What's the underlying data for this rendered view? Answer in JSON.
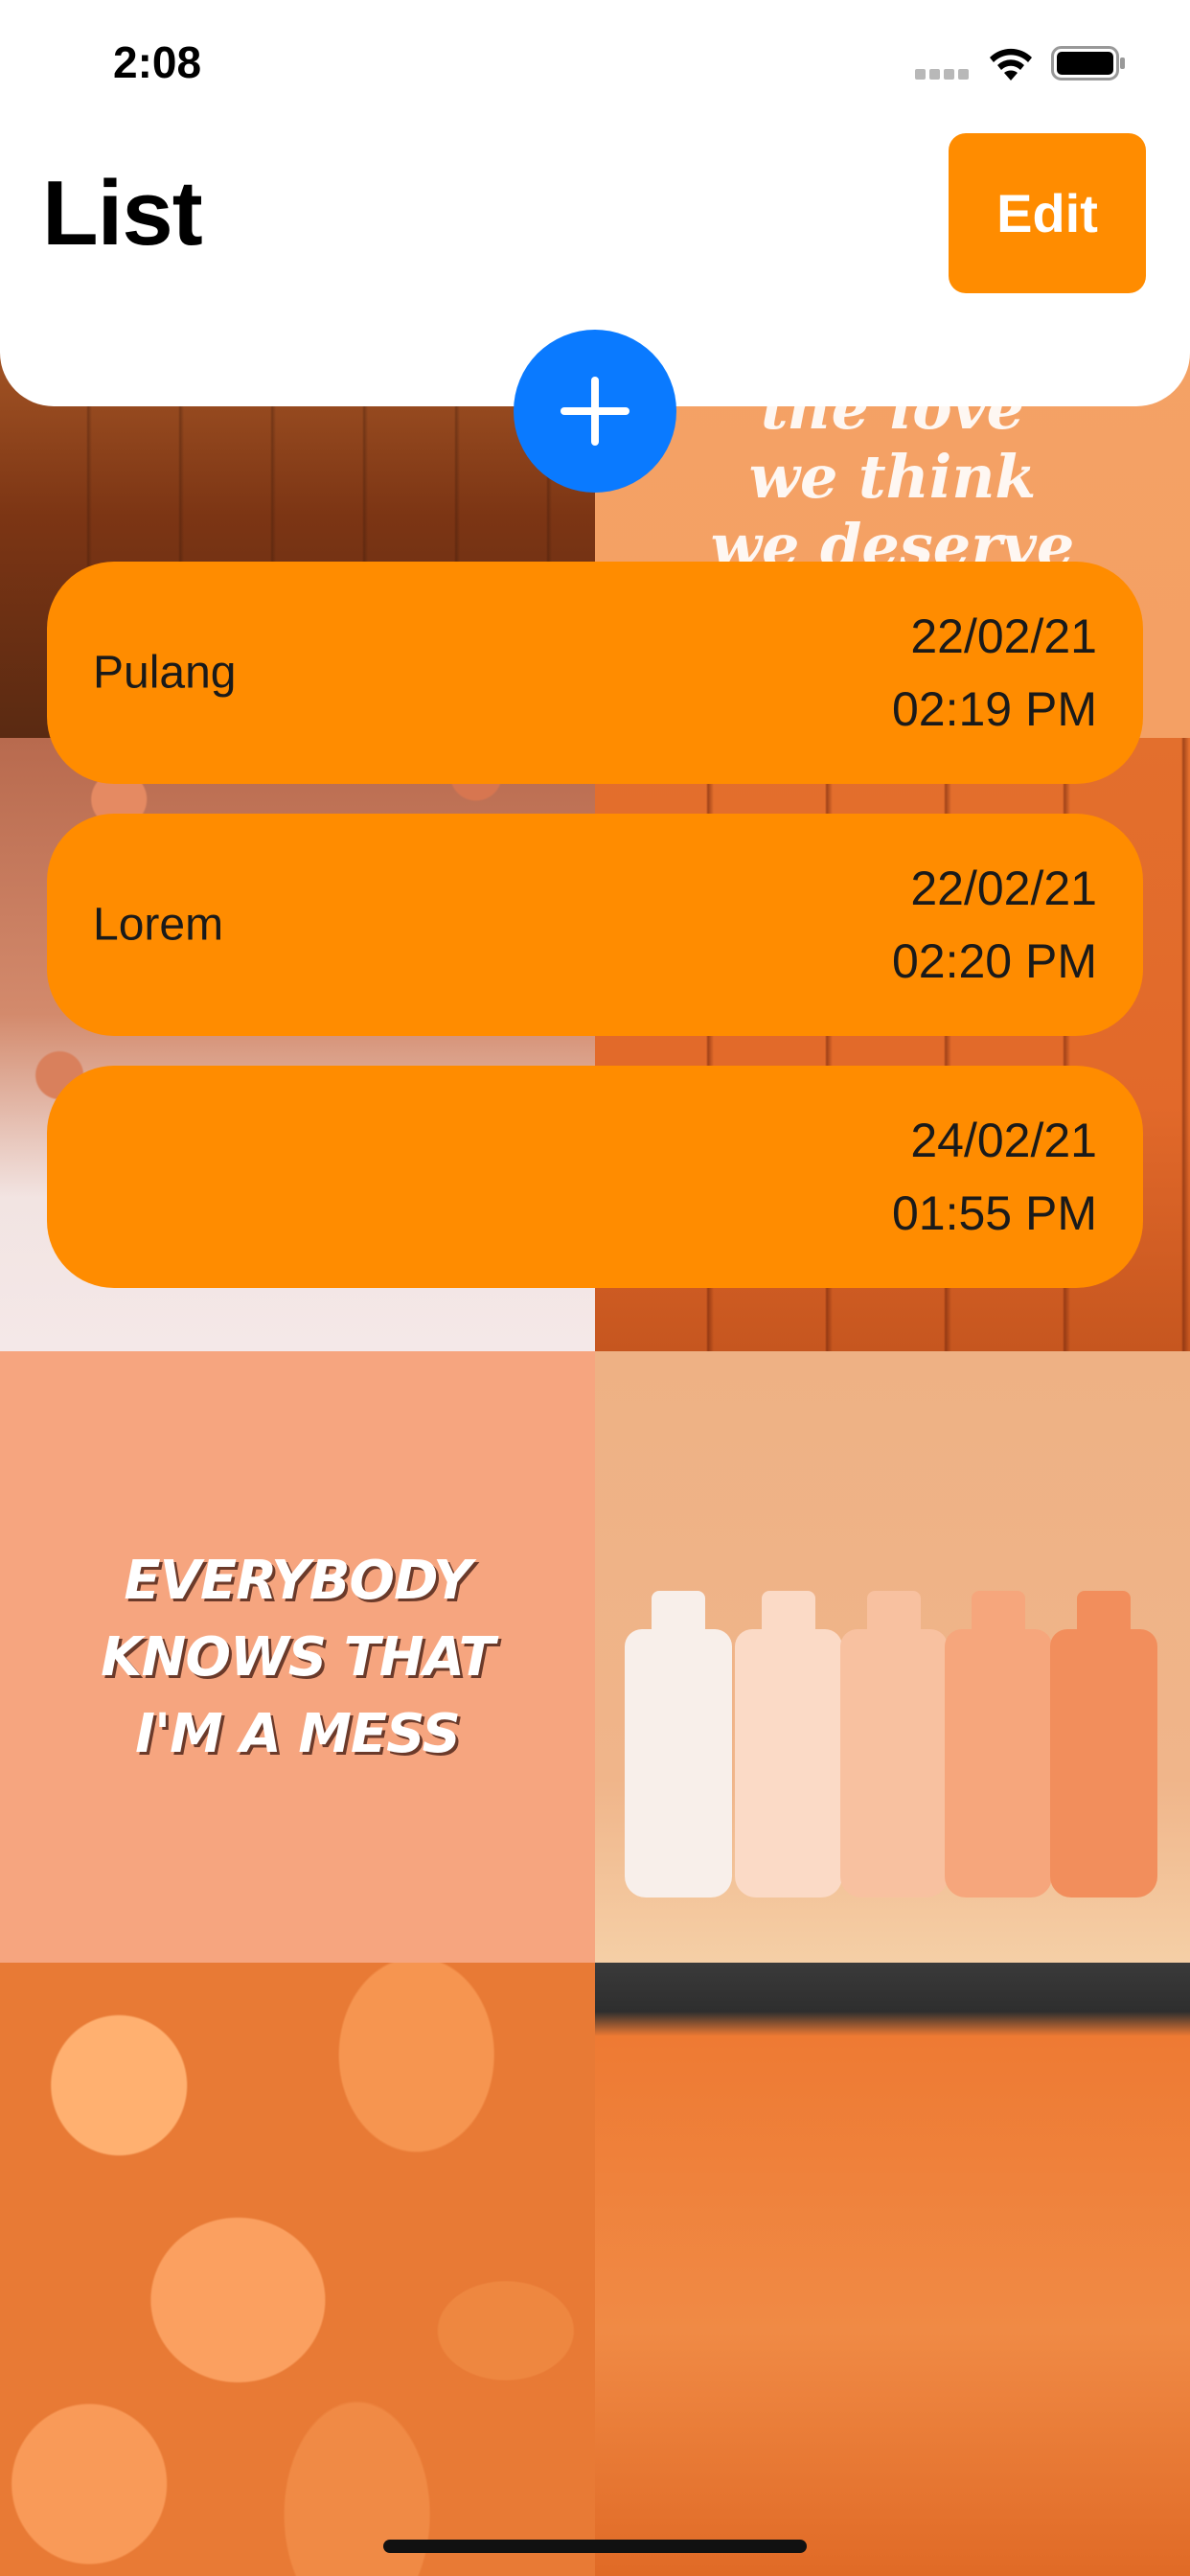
{
  "status_bar": {
    "time": "2:08",
    "icons": [
      "signal-icon",
      "wifi-icon",
      "battery-icon"
    ]
  },
  "header": {
    "title": "List",
    "edit_label": "Edit"
  },
  "add_button": {
    "icon": "plus-icon"
  },
  "items": [
    {
      "title": "Pulang",
      "date": "22/02/21",
      "time": "02:19 PM"
    },
    {
      "title": "Lorem",
      "date": "22/02/21",
      "time": "02:20 PM"
    },
    {
      "title": "",
      "date": "24/02/21",
      "time": "01:55 PM"
    }
  ],
  "background": {
    "quote_top": "the love\nwe think\nwe deserve",
    "quote_middle": "EVERYBODY\nKNOWS THAT\nI'M A MESS"
  },
  "colors": {
    "accent": "#ff8c00",
    "add_button": "#0a7aff",
    "header_bg": "#ffffff"
  }
}
